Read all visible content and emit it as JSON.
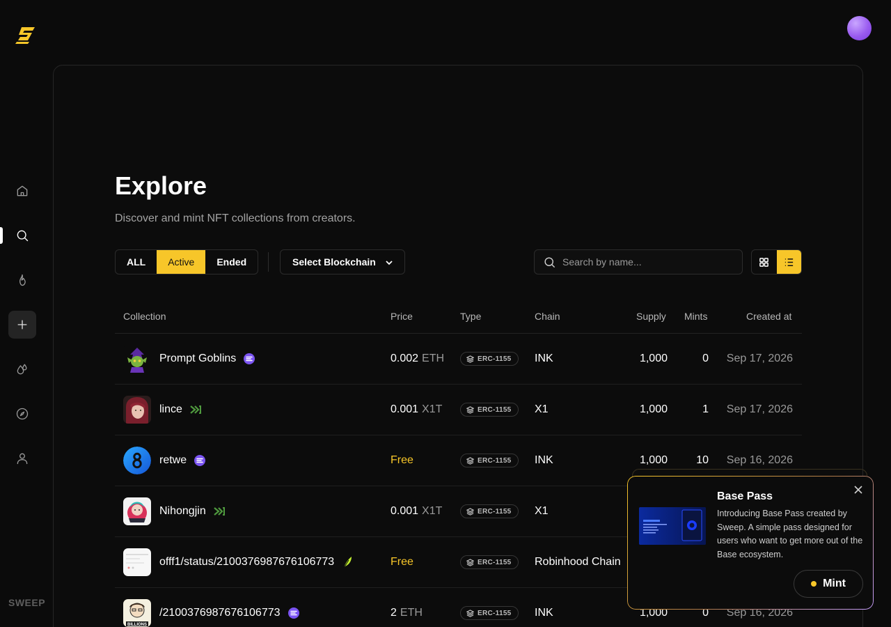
{
  "brand": {
    "footer": "SWEEP",
    "accent": "#f7c629"
  },
  "sidebar": {
    "items": [
      {
        "icon": "home-icon"
      },
      {
        "icon": "search-icon",
        "active": true
      },
      {
        "icon": "flame-icon"
      },
      {
        "icon": "plus-icon"
      },
      {
        "icon": "drops-icon"
      },
      {
        "icon": "compass-icon"
      },
      {
        "icon": "user-icon"
      }
    ]
  },
  "page": {
    "title": "Explore",
    "subtitle": "Discover and mint NFT collections from creators."
  },
  "filters": {
    "status": [
      "ALL",
      "Active",
      "Ended"
    ],
    "status_selected": "Active",
    "blockchain_label": "Select Blockchain"
  },
  "search": {
    "placeholder": "Search by name..."
  },
  "view": {
    "mode": "list"
  },
  "table": {
    "headers": [
      "Collection",
      "Price",
      "Type",
      "Chain",
      "Supply",
      "Mints",
      "Created at"
    ],
    "rows": [
      {
        "name": "Prompt Goblins",
        "badge": "ink-chain-icon",
        "price": "0.002",
        "currency": "ETH",
        "type": "ERC-1155",
        "chain": "INK",
        "supply": "1,000",
        "mints": "0",
        "created": "Sep 17, 2026"
      },
      {
        "name": "lince",
        "badge": "x1-chain-icon",
        "price": "0.001",
        "currency": "X1T",
        "type": "ERC-1155",
        "chain": "X1",
        "supply": "1,000",
        "mints": "1",
        "created": "Sep 17, 2026"
      },
      {
        "name": "retwe",
        "badge": "ink-chain-icon",
        "price": "Free",
        "currency": "",
        "type": "ERC-1155",
        "chain": "INK",
        "supply": "1,000",
        "mints": "10",
        "created": "Sep 16, 2026"
      },
      {
        "name": "Nihongjin",
        "badge": "x1-chain-icon",
        "price": "0.001",
        "currency": "X1T",
        "type": "ERC-1155",
        "chain": "X1",
        "supply": "",
        "mints": "",
        "created": ""
      },
      {
        "name": "offf1/status/2100376987676106773",
        "badge": "robinhood-chain-icon",
        "price": "Free",
        "currency": "",
        "type": "ERC-1155",
        "chain": "Robinhood Chain",
        "supply": "",
        "mints": "",
        "created": ""
      },
      {
        "name": "/2100376987676106773",
        "badge": "ink-chain-icon",
        "price": "2",
        "currency": "ETH",
        "type": "ERC-1155",
        "chain": "INK",
        "supply": "1,000",
        "mints": "0",
        "created": "Sep 16, 2026"
      }
    ]
  },
  "popup": {
    "title": "Base Pass",
    "description": "Introducing Base Pass created by Sweep. A simple pass designed for users who want to get more out of the Base ecosystem.",
    "button": "Mint"
  }
}
